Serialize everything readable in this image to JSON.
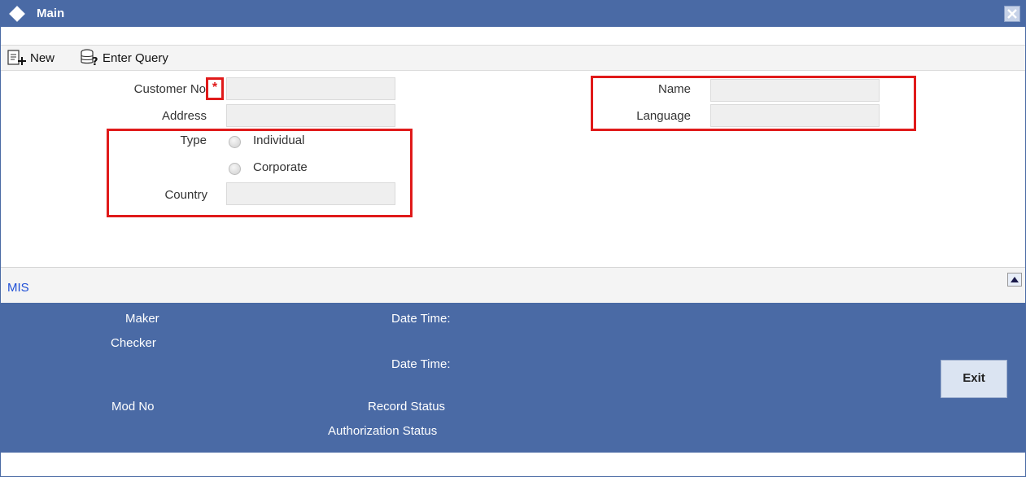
{
  "window": {
    "title": "Main"
  },
  "toolbar": {
    "new_label": "New",
    "enter_query_label": "Enter Query"
  },
  "form": {
    "customer_no": {
      "label": "Customer No",
      "required_mark": "*",
      "value": ""
    },
    "address": {
      "label": "Address",
      "value": ""
    },
    "type": {
      "label": "Type",
      "options": [
        "Individual",
        "Corporate"
      ],
      "selected": null
    },
    "country": {
      "label": "Country",
      "value": ""
    },
    "name": {
      "label": "Name",
      "value": ""
    },
    "language": {
      "label": "Language",
      "value": ""
    }
  },
  "mis": {
    "title": "MIS",
    "maker_label": "Maker",
    "checker_label": "Checker",
    "date_time_label_1": "Date Time:",
    "date_time_label_2": "Date Time:",
    "mod_no_label": "Mod No",
    "record_status_label": "Record Status",
    "authorization_status_label": "Authorization Status",
    "exit_label": "Exit"
  },
  "colors": {
    "title_bar": "#4a6aa5",
    "highlight": "#e01a1a",
    "mis_link": "#1f4fd6"
  }
}
